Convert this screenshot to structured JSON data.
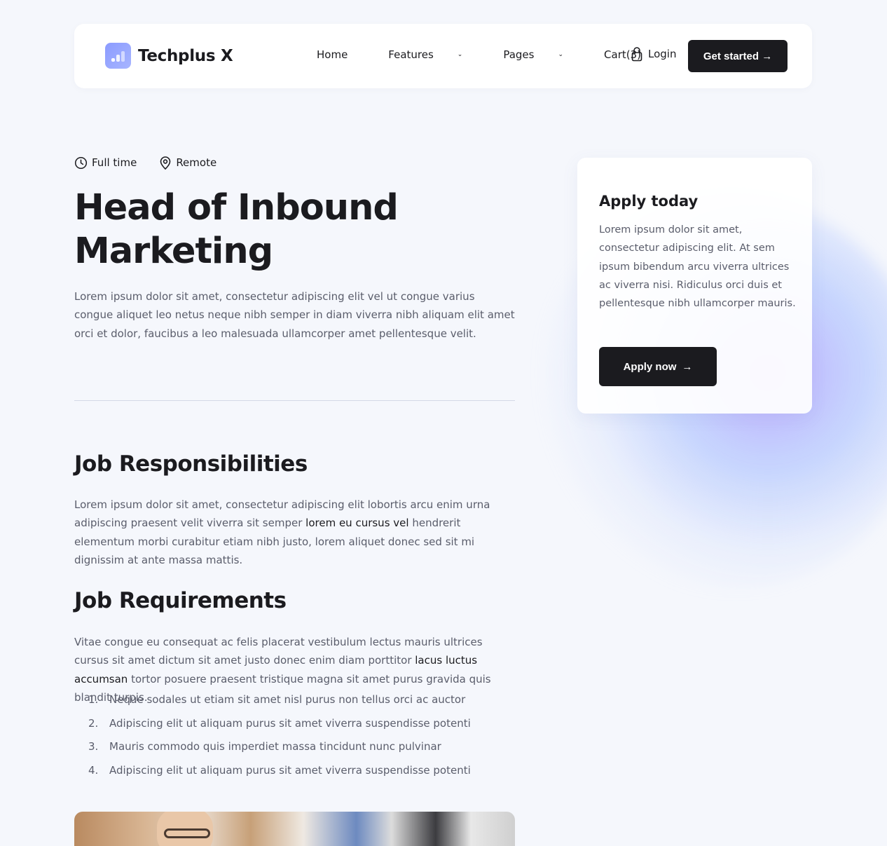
{
  "header": {
    "brand": "Techplus X",
    "nav": [
      {
        "label": "Home",
        "dropdown": false
      },
      {
        "label": "Features",
        "dropdown": true
      },
      {
        "label": "Pages",
        "dropdown": true
      },
      {
        "label": "Cart(3)",
        "dropdown": false
      }
    ],
    "login_label": "Login",
    "cta_label": "Get started",
    "arrow": "→",
    "chevron": "⌄"
  },
  "job": {
    "meta": [
      {
        "icon": "clock-icon",
        "label": "Full time"
      },
      {
        "icon": "location-pin-icon",
        "label": "Remote"
      }
    ],
    "title": "Head of Inbound Marketing",
    "intro": "Lorem ipsum dolor sit amet, consectetur adipiscing elit vel ut congue varius congue aliquet leo netus neque nibh semper in diam viverra nibh aliquam elit amet orci et dolor, faucibus a leo malesuada ullamcorper amet pellentesque velit."
  },
  "responsibilities": {
    "heading": "Job Responsibilities",
    "text_before": "Lorem ipsum dolor sit amet, consectetur adipiscing elit lobortis arcu enim urna adipiscing praesent velit viverra sit semper ",
    "text_strong": "lorem eu cursus vel",
    "text_after": " hendrerit elementum morbi curabitur etiam nibh justo, lorem aliquet donec sed sit mi dignissim at ante massa mattis."
  },
  "requirements": {
    "heading": "Job Requirements",
    "text_before": "Vitae congue eu consequat ac felis placerat vestibulum lectus mauris ultrices cursus sit amet dictum sit amet justo donec enim diam porttitor ",
    "text_strong": "lacus luctus accumsan",
    "text_after": " tortor posuere praesent tristique magna sit amet purus gravida quis blandit turpis.",
    "items": [
      {
        "num": "1.",
        "text": "Neque sodales ut etiam sit amet nisl purus non tellus orci ac auctor"
      },
      {
        "num": "2.",
        "text": "Adipiscing elit ut aliquam purus sit amet viverra suspendisse potenti"
      },
      {
        "num": "3.",
        "text": "Mauris commodo quis imperdiet massa tincidunt nunc pulvinar"
      },
      {
        "num": "4.",
        "text": "Adipiscing elit ut aliquam purus sit amet viverra suspendisse potenti"
      }
    ]
  },
  "apply": {
    "title": "Apply today",
    "text": "Lorem ipsum dolor sit amet, consectetur adipiscing elit. At sem ipsum bibendum arcu viverra ultrices ac viverra nisi. Ridiculus orci duis et pellentesque nibh ullamcorper mauris.",
    "button_label": "Apply now",
    "arrow": "→"
  },
  "colors": {
    "text_dark": "#1b1b1f",
    "text_muted": "#5a5d6b",
    "background": "#f5f7fc",
    "logo_accent": "#8b9bff"
  }
}
